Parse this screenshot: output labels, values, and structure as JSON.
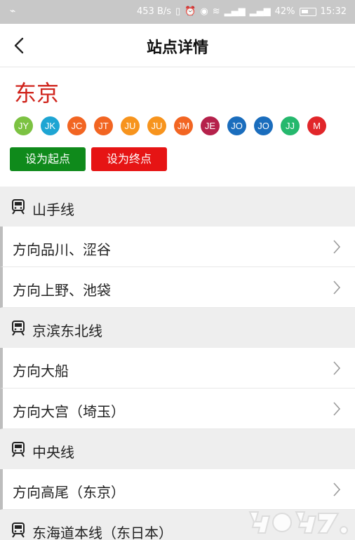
{
  "statusbar": {
    "speed": "453 B/s",
    "battery": "42%",
    "time": "15:32"
  },
  "nav": {
    "title": "站点详情"
  },
  "station": {
    "name": "东京"
  },
  "lines": [
    {
      "code": "JY",
      "color": "#7cc242"
    },
    {
      "code": "JK",
      "color": "#1ea5d3"
    },
    {
      "code": "JC",
      "color": "#f26522"
    },
    {
      "code": "JT",
      "color": "#f26522"
    },
    {
      "code": "JU",
      "color": "#f7941d"
    },
    {
      "code": "JU",
      "color": "#f7941d"
    },
    {
      "code": "JM",
      "color": "#f26522"
    },
    {
      "code": "JE",
      "color": "#b5214b"
    },
    {
      "code": "JO",
      "color": "#1a6dbd"
    },
    {
      "code": "JO",
      "color": "#1a6dbd"
    },
    {
      "code": "JJ",
      "color": "#25b86d"
    },
    {
      "code": "M",
      "color": "#e1262a"
    }
  ],
  "buttons": {
    "set_start": "设为起点",
    "set_end": "设为终点"
  },
  "sections": [
    {
      "name": "山手线",
      "directions": [
        "方向品川、涩谷",
        "方向上野、池袋"
      ]
    },
    {
      "name": "京滨东北线",
      "directions": [
        "方向大船",
        "方向大宫（埼玉）"
      ]
    },
    {
      "name": "中央线",
      "directions": [
        "方向高尾（东京）"
      ]
    },
    {
      "name": "东海道本线（东日本）",
      "directions": []
    }
  ]
}
